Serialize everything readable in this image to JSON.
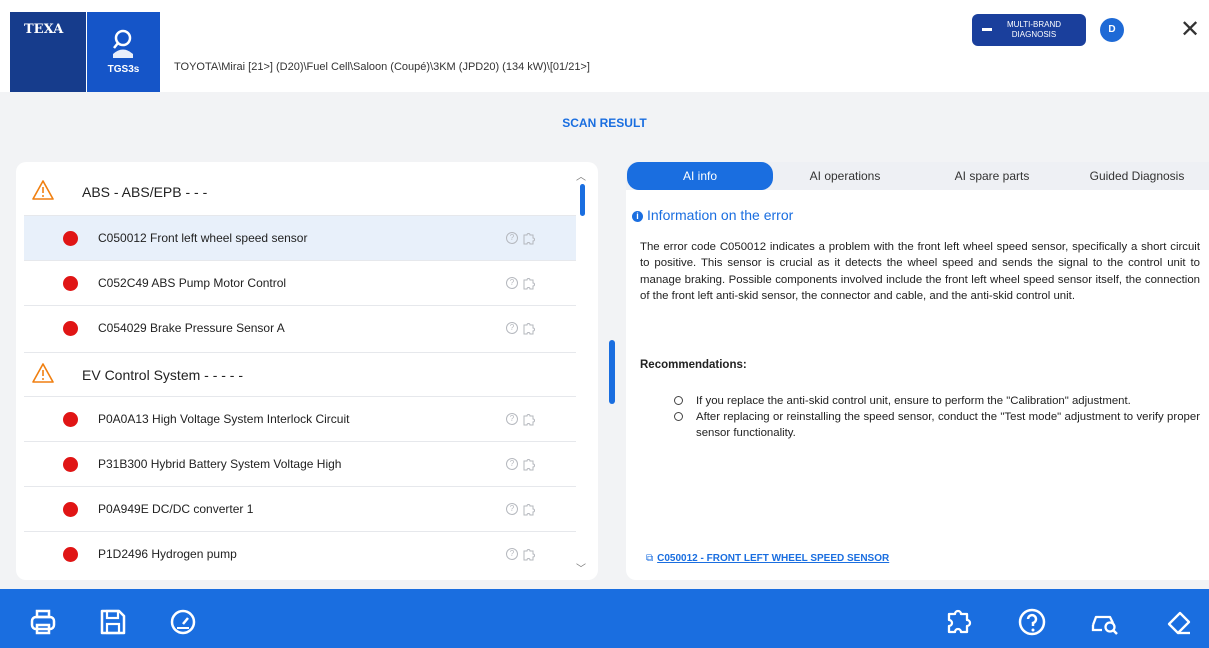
{
  "header": {
    "logo_texa": "TEXA",
    "logo_product": "TGS3s",
    "breadcrumb": "TOYOTA\\Mirai [21>] (D20)\\Fuel Cell\\Saloon (Coupé)\\3KM (JPD20) (134 kW)\\[01/21>]",
    "multibrand_line1": "MULTI-BRAND",
    "multibrand_line2": "DIAGNOSIS",
    "avatar_initial": "D",
    "close_glyph": "✕"
  },
  "page_title": "SCAN RESULT",
  "groups": [
    {
      "title": "ABS - ABS/EPB - - -",
      "errors": [
        {
          "code_desc": "C050012 Front left wheel speed sensor",
          "selected": true
        },
        {
          "code_desc": "C052C49 ABS Pump Motor Control",
          "selected": false
        },
        {
          "code_desc": "C054029 Brake Pressure Sensor A",
          "selected": false
        }
      ]
    },
    {
      "title": "EV Control System - - - - -",
      "errors": [
        {
          "code_desc": "P0A0A13 High Voltage System Interlock Circuit",
          "selected": false
        },
        {
          "code_desc": "P31B300 Hybrid Battery System Voltage High",
          "selected": false
        },
        {
          "code_desc": "P0A949E DC/DC converter 1",
          "selected": false
        },
        {
          "code_desc": "P1D2496 Hydrogen pump",
          "selected": false
        }
      ]
    }
  ],
  "tabs": [
    {
      "label": "AI info",
      "active": true
    },
    {
      "label": "AI operations",
      "active": false
    },
    {
      "label": "AI spare parts",
      "active": false
    },
    {
      "label": "Guided Diagnosis",
      "active": false
    }
  ],
  "info": {
    "heading": "Information on the error",
    "body": "The error code C050012 indicates a problem with the front left wheel speed sensor, specifically a short circuit to positive. This sensor is crucial as it detects the wheel speed and sends the signal to the control unit to manage braking. Possible components involved include the front left wheel speed sensor itself, the connection of the front left anti-skid sensor, the connector and cable, and the anti-skid control unit.",
    "recommendations_heading": "Recommendations:",
    "recommendations": [
      "If you replace the anti-skid control unit, ensure to perform the \"Calibration\" adjustment.",
      "After replacing or reinstalling the speed sensor, conduct the \"Test mode\" adjustment to verify proper sensor functionality."
    ],
    "reference_link": "C050012 - FRONT LEFT WHEEL SPEED SENSOR"
  },
  "colors": {
    "accent": "#1a6ee0",
    "error_dot": "#e01515",
    "warning": "#f07f10",
    "texa_blue": "#163c8c"
  },
  "icons": {
    "footer_left": [
      "print-icon",
      "save-icon",
      "gauge-icon"
    ],
    "footer_right": [
      "puzzle-icon",
      "help-icon",
      "car-search-icon",
      "eraser-icon"
    ]
  }
}
